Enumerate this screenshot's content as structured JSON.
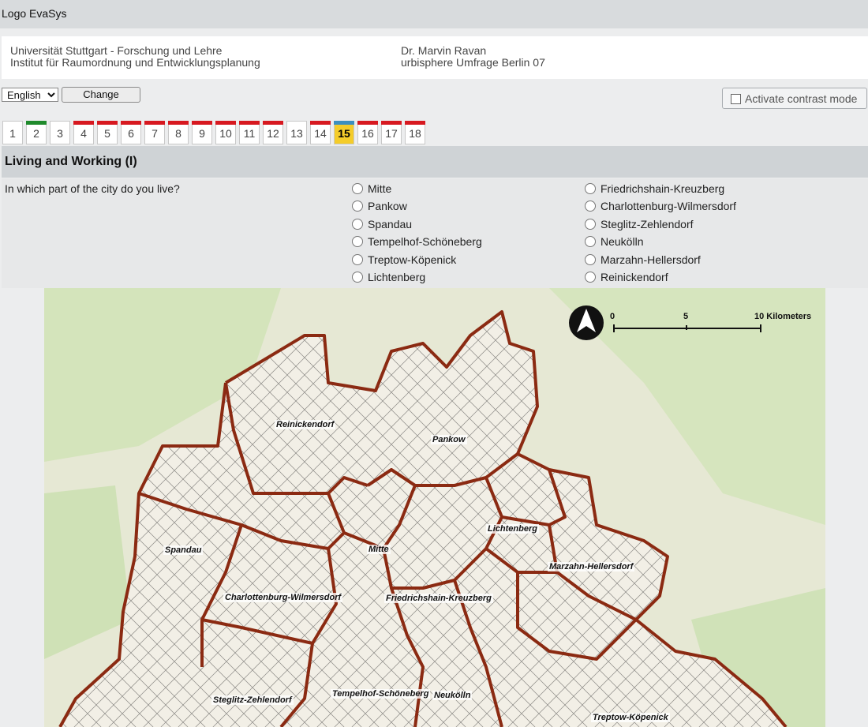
{
  "header": {
    "logo_text": "Logo EvaSys"
  },
  "info": {
    "university": "Universität Stuttgart - Forschung und Lehre",
    "institute": "Institut für Raumordnung und Entwicklungsplanung",
    "author": "Dr. Marvin Ravan",
    "survey": "urbisphere Umfrage Berlin 07"
  },
  "language": {
    "selected": "English",
    "change_label": "Change"
  },
  "contrast": {
    "label": "Activate contrast mode"
  },
  "pages": [
    {
      "label": "1",
      "state": "none"
    },
    {
      "label": "2",
      "state": "green"
    },
    {
      "label": "3",
      "state": "none"
    },
    {
      "label": "4",
      "state": "red"
    },
    {
      "label": "5",
      "state": "red"
    },
    {
      "label": "6",
      "state": "red"
    },
    {
      "label": "7",
      "state": "red"
    },
    {
      "label": "8",
      "state": "red"
    },
    {
      "label": "9",
      "state": "red"
    },
    {
      "label": "10",
      "state": "red"
    },
    {
      "label": "11",
      "state": "red"
    },
    {
      "label": "12",
      "state": "red"
    },
    {
      "label": "13",
      "state": "none"
    },
    {
      "label": "14",
      "state": "red"
    },
    {
      "label": "15",
      "state": "current"
    },
    {
      "label": "16",
      "state": "red"
    },
    {
      "label": "17",
      "state": "red"
    },
    {
      "label": "18",
      "state": "red"
    }
  ],
  "section": {
    "title": "Living and Working (I)"
  },
  "question": {
    "text": "In which part of the city do you live?",
    "options_left": [
      "Mitte",
      "Pankow",
      "Spandau",
      "Tempelhof-Schöneberg",
      "Treptow-Köpenick",
      "Lichtenberg"
    ],
    "options_right": [
      "Friedrichshain-Kreuzberg",
      "Charlottenburg-Wilmersdorf",
      "Steglitz-Zehlendorf",
      "Neukölln",
      "Marzahn-Hellersdorf",
      "Reinickendorf"
    ]
  },
  "map": {
    "scale": {
      "zero": "0",
      "mid": "5",
      "end": "10 Kilometers"
    },
    "districts": [
      "Reinickendorf",
      "Pankow",
      "Lichtenberg",
      "Spandau",
      "Mitte",
      "Marzahn-Hellersdorf",
      "Charlottenburg-Wilmersdorf",
      "Friedrichshain-Kreuzberg",
      "Steglitz-Zehlendorf",
      "Tempelhof-Schöneberg",
      "Neukölln",
      "Treptow-Köpenick"
    ]
  },
  "colors": {
    "page_red": "#d71920",
    "page_green": "#1f8a2c",
    "page_current": "#f4cc2a",
    "district_border": "#8b2a12"
  }
}
